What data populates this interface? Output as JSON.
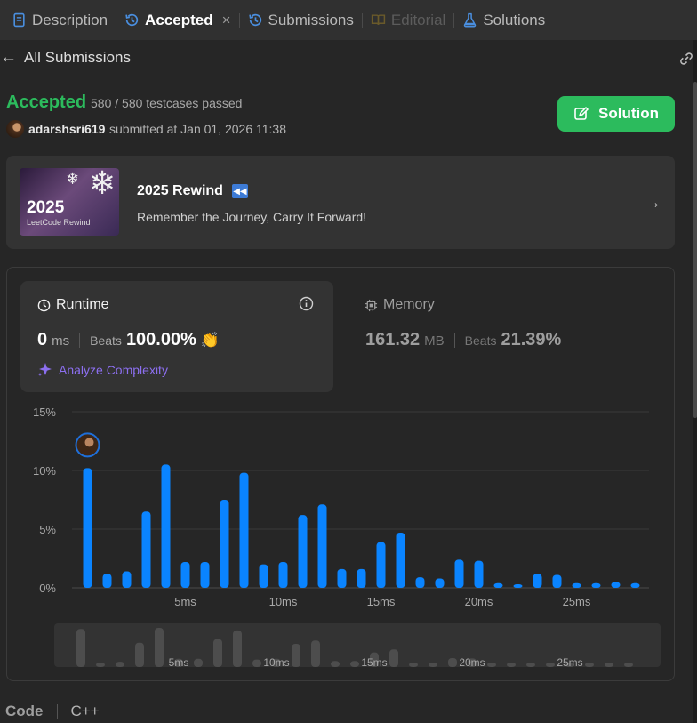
{
  "tabs": [
    {
      "label": "Description",
      "icon": "description-icon",
      "state": "normal"
    },
    {
      "label": "Accepted",
      "icon": "history-icon",
      "state": "active"
    },
    {
      "label": "Submissions",
      "icon": "history-icon",
      "state": "normal"
    },
    {
      "label": "Editorial",
      "icon": "book-icon",
      "state": "disabled"
    },
    {
      "label": "Solutions",
      "icon": "flask-icon",
      "state": "normal"
    }
  ],
  "close_glyph": "×",
  "header": {
    "back_label": "All Submissions"
  },
  "submission": {
    "status": "Accepted",
    "testcases": "580 / 580 testcases passed",
    "author": "adarshsri619",
    "submitted": "submitted at Jan 01, 2026 11:38",
    "solution_button": "Solution"
  },
  "banner": {
    "image_year": "2025",
    "image_caption": "LeetCode Rewind",
    "title": "2025 Rewind",
    "subtitle": "Remember the Journey, Carry It Forward!"
  },
  "runtime": {
    "title": "Runtime",
    "value": "0",
    "unit": "ms",
    "beats_label": "Beats",
    "beats_value": "100.00%",
    "analyze_label": "Analyze Complexity"
  },
  "memory": {
    "title": "Memory",
    "value": "161.32",
    "unit": "MB",
    "beats_label": "Beats",
    "beats_value": "21.39%"
  },
  "code": {
    "label": "Code",
    "language": "C++"
  },
  "colors": {
    "accent_green": "#2cbb5d",
    "bar_blue": "#0a84ff",
    "analyze_purple": "#8c6ff0"
  },
  "chart_data": {
    "type": "bar",
    "series": [
      {
        "values": [
          10.2,
          1.2,
          1.4,
          6.5,
          10.5,
          2.2,
          2.2,
          7.5,
          9.8,
          2.0,
          2.2,
          6.2,
          7.1,
          1.6,
          1.6,
          3.9,
          4.7,
          0.9,
          0.8,
          2.4,
          2.3,
          0.4,
          0.3,
          1.2,
          1.1,
          0.4,
          0.4,
          0.5,
          0.4
        ]
      }
    ],
    "ylim": [
      0,
      15
    ],
    "yticks": [
      "0%",
      "5%",
      "10%",
      "15%"
    ],
    "xticks": [
      "5ms",
      "10ms",
      "15ms",
      "20ms",
      "25ms"
    ],
    "grid": true,
    "highlight_index": 0
  }
}
